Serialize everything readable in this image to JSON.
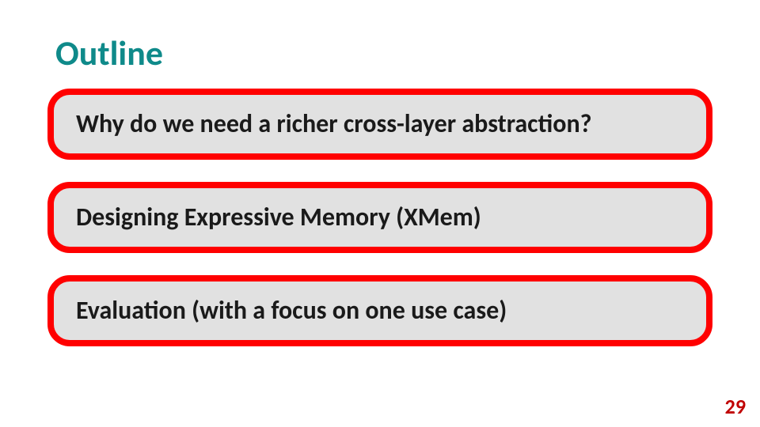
{
  "title": "Outline",
  "items": [
    {
      "text": "Why do we need a richer cross-layer abstraction?"
    },
    {
      "text": "Designing Expressive Memory (XMem)"
    },
    {
      "text": "Evaluation (with a focus on one use case)"
    }
  ],
  "page_number": "29"
}
